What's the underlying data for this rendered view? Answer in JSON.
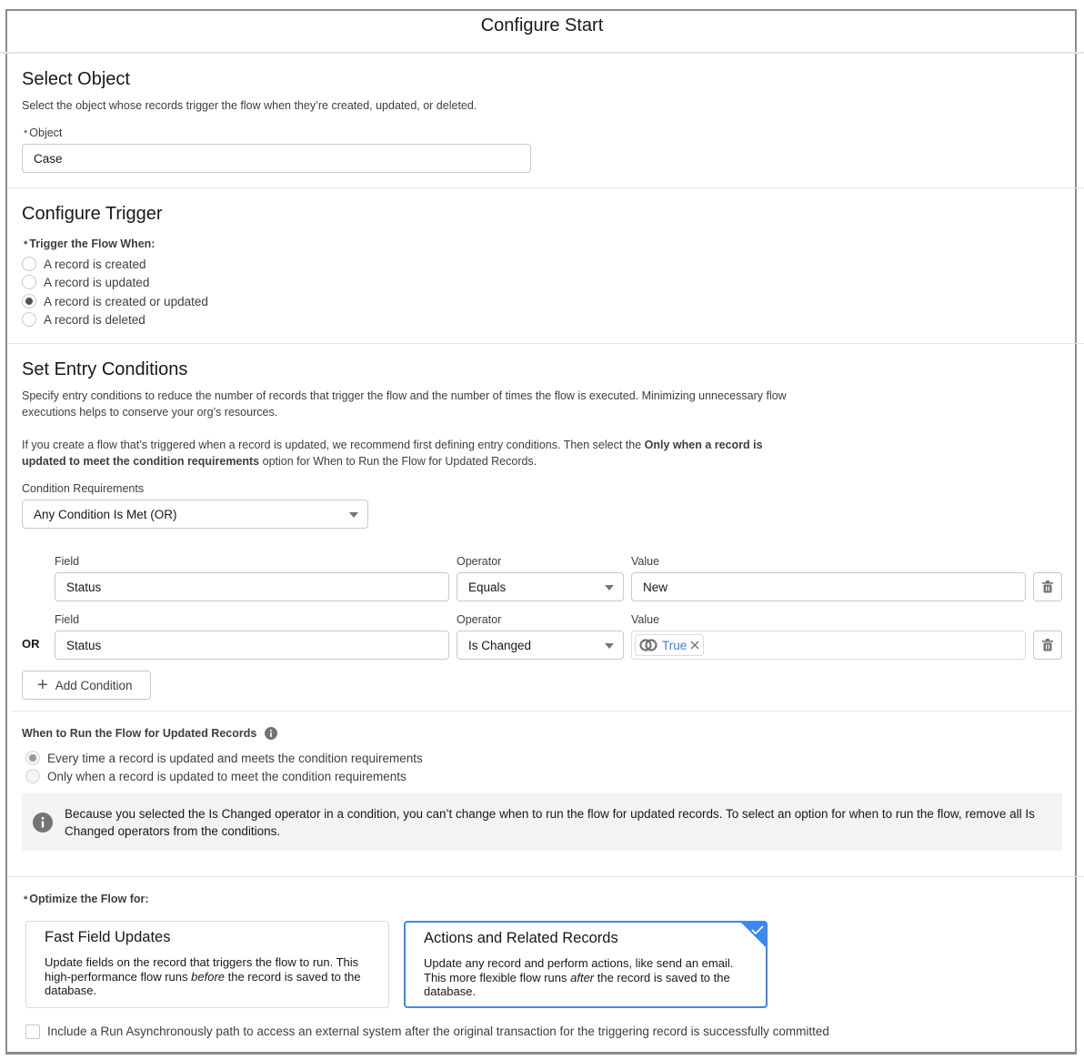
{
  "header": {
    "title": "Configure Start"
  },
  "select_object": {
    "heading": "Select Object",
    "description": "Select the object whose records trigger the flow when they’re created, updated, or deleted.",
    "object_label": "Object",
    "required_mark": "*",
    "object_value": "Case"
  },
  "configure_trigger": {
    "heading": "Configure Trigger",
    "required_mark": "*",
    "label": "Trigger the Flow When:",
    "options": [
      {
        "label": "A record is created",
        "checked": false
      },
      {
        "label": "A record is updated",
        "checked": false
      },
      {
        "label": "A record is created or updated",
        "checked": true
      },
      {
        "label": "A record is deleted",
        "checked": false
      }
    ]
  },
  "entry_conditions": {
    "heading": "Set Entry Conditions",
    "description_1": "Specify entry conditions to reduce the number of records that trigger the flow and the number of times the flow is executed. Minimizing unnecessary flow executions helps to conserve your org’s resources.",
    "description_2_prefix": "If you create a flow that’s triggered when a record is updated, we recommend first defining entry conditions. Then select the ",
    "description_2_bold": "Only when a record is updated to meet the condition requirements",
    "description_2_suffix": " option for When to Run the Flow for Updated Records.",
    "requirements_label": "Condition Requirements",
    "requirements_value": "Any Condition Is Met (OR)",
    "field_label": "Field",
    "operator_label": "Operator",
    "value_label": "Value",
    "conditions": [
      {
        "connector": "",
        "field": "Status",
        "operator": "Equals",
        "value": "New"
      },
      {
        "connector": "OR",
        "field": "Status",
        "operator": "Is Changed",
        "value_pill": "True"
      }
    ],
    "add_condition_label": "Add Condition"
  },
  "when_to_run": {
    "label": "When to Run the Flow for Updated Records",
    "options": [
      {
        "label": "Every time a record is updated and meets the condition requirements",
        "checked": true
      },
      {
        "label": "Only when a record is updated to meet the condition requirements",
        "checked": false
      }
    ],
    "info_message": "Because you selected the Is Changed operator in a condition, you can’t change when to run the flow for updated records. To select an option for when to run the flow, remove all Is Changed operators from the conditions."
  },
  "optimize": {
    "required_mark": "*",
    "label": "Optimize the Flow for:",
    "cards": [
      {
        "title": "Fast Field Updates",
        "desc_prefix": "Update fields on the record that triggers the flow to run. This high-performance flow runs ",
        "desc_em": "before",
        "desc_suffix": " the record is saved to the database.",
        "selected": false
      },
      {
        "title": "Actions and Related Records",
        "desc_prefix": "Update any record and perform actions, like send an email. This more flexible flow runs ",
        "desc_em": "after",
        "desc_suffix": " the record is saved to the database.",
        "selected": true
      }
    ],
    "async_checkbox_label": "Include a Run Asynchronously path to access an external system after the original transaction for the triggering record is successfully committed",
    "async_checked": false
  },
  "colors": {
    "accent": "#3a88f0",
    "pill_text": "#3a80d6",
    "info_bg": "#f3f3f3"
  }
}
